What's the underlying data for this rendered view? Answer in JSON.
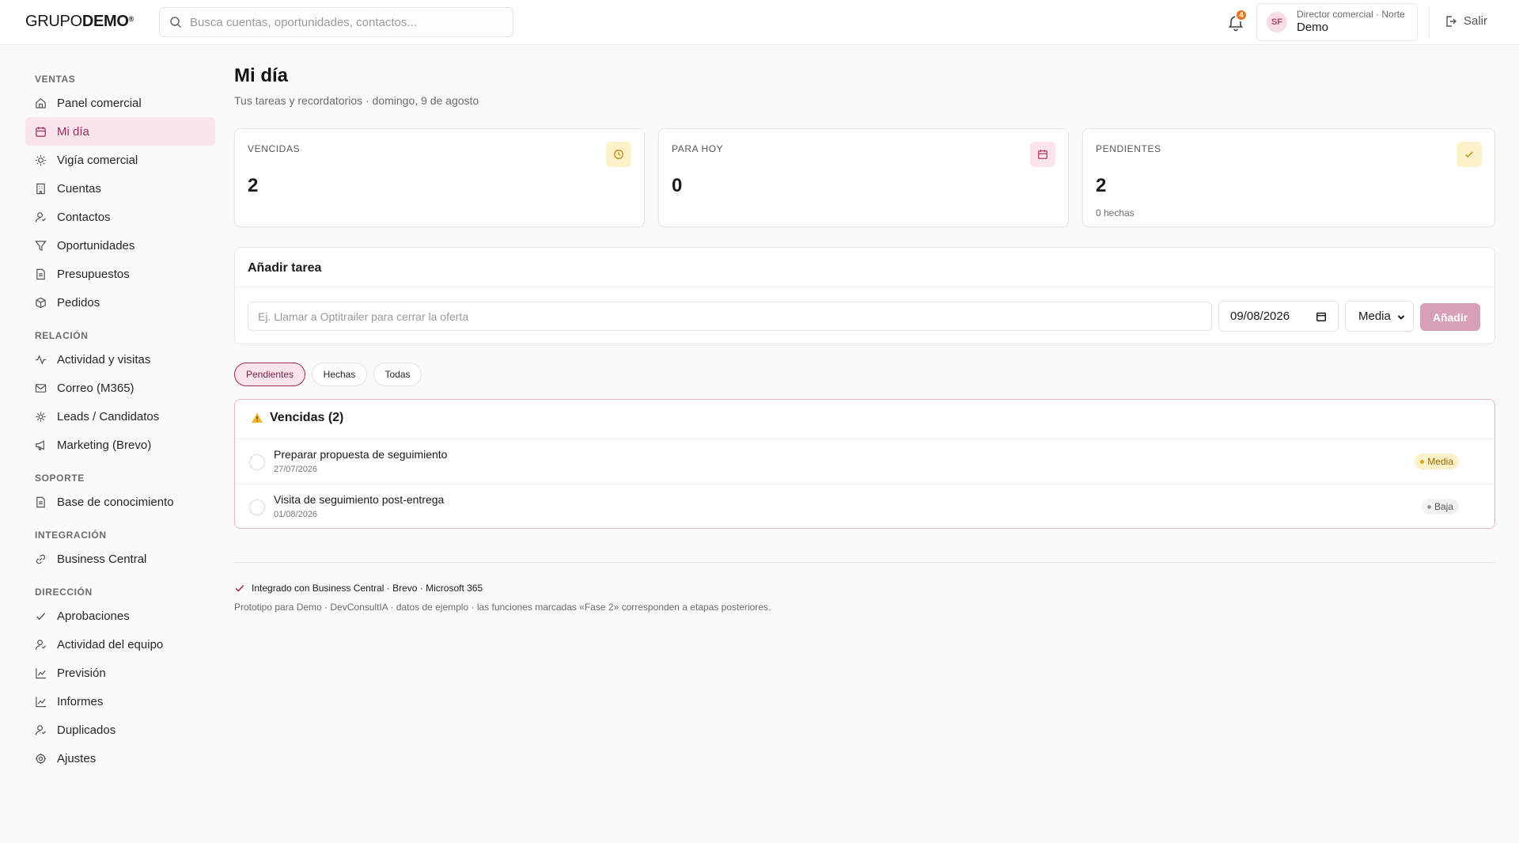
{
  "header": {
    "logo_light": "GRUPO",
    "logo_bold": "DEMO",
    "logo_mark": "®",
    "search_placeholder": "Busca cuentas, oportunidades, contactos...",
    "notification_count": "4",
    "user_initials": "SF",
    "user_role": "Director comercial · Norte",
    "user_name": "Demo",
    "logout_label": "Salir"
  },
  "sidebar": {
    "sections": [
      {
        "label": "VENTAS",
        "items": [
          {
            "label": "Panel comercial",
            "icon": "home-icon"
          },
          {
            "label": "Mi día",
            "icon": "calendar-icon",
            "active": true
          },
          {
            "label": "Vigía comercial",
            "icon": "sun-icon"
          },
          {
            "label": "Cuentas",
            "icon": "building-icon"
          },
          {
            "label": "Contactos",
            "icon": "contacts-icon"
          },
          {
            "label": "Oportunidades",
            "icon": "funnel-icon"
          },
          {
            "label": "Presupuestos",
            "icon": "document-icon"
          },
          {
            "label": "Pedidos",
            "icon": "package-icon"
          }
        ]
      },
      {
        "label": "RELACIÓN",
        "items": [
          {
            "label": "Actividad y visitas",
            "icon": "activity-icon"
          },
          {
            "label": "Correo (M365)",
            "icon": "mail-icon"
          },
          {
            "label": "Leads / Candidatos",
            "icon": "sparkle-icon"
          },
          {
            "label": "Marketing (Brevo)",
            "icon": "megaphone-icon"
          }
        ]
      },
      {
        "label": "SOPORTE",
        "items": [
          {
            "label": "Base de conocimiento",
            "icon": "document-icon"
          }
        ]
      },
      {
        "label": "INTEGRACIÓN",
        "items": [
          {
            "label": "Business Central",
            "icon": "link-icon"
          }
        ]
      },
      {
        "label": "DIRECCIÓN",
        "items": [
          {
            "label": "Aprobaciones",
            "icon": "check-icon"
          },
          {
            "label": "Actividad del equipo",
            "icon": "team-icon"
          },
          {
            "label": "Previsión",
            "icon": "chart-icon"
          },
          {
            "label": "Informes",
            "icon": "chart-icon"
          },
          {
            "label": "Duplicados",
            "icon": "duplicate-icon"
          },
          {
            "label": "Ajustes",
            "icon": "gear-icon"
          }
        ]
      }
    ]
  },
  "page": {
    "title": "Mi día",
    "subtitle": "Tus tareas y recordatorios · domingo, 9 de agosto"
  },
  "stats": [
    {
      "label": "VENCIDAS",
      "value": "2",
      "sub": "",
      "icon": "clock-icon",
      "icon_bg": "#fdf1c9",
      "icon_color": "#c8911a"
    },
    {
      "label": "PARA HOY",
      "value": "0",
      "sub": "",
      "icon": "calendar-icon",
      "icon_bg": "#fbe4ec",
      "icon_color": "#b0416a"
    },
    {
      "label": "PENDIENTES",
      "value": "2",
      "sub": "0 hechas",
      "icon": "check-icon",
      "icon_bg": "#fdf1c9",
      "icon_color": "#c8911a"
    }
  ],
  "add_task": {
    "title": "Añadir tarea",
    "placeholder": "Ej. Llamar a Optitrailer para cerrar la oferta",
    "date_value": "09/08/2026",
    "priority_value": "Media",
    "button_label": "Añadir"
  },
  "filters": [
    {
      "label": "Pendientes",
      "active": true
    },
    {
      "label": "Hechas",
      "active": false
    },
    {
      "label": "Todas",
      "active": false
    }
  ],
  "overdue": {
    "heading": "Vencidas (2)",
    "tasks": [
      {
        "title": "Preparar propuesta de seguimiento",
        "date": "27/07/2026",
        "priority": "Media",
        "badge_bg": "#fdf1c9",
        "badge_color": "#9a6a00",
        "dot_color": "#e0a11c"
      },
      {
        "title": "Visita de seguimiento post-entrega",
        "date": "01/08/2026",
        "priority": "Baja",
        "badge_bg": "#f2f2f2",
        "badge_color": "#555555",
        "dot_color": "#9a9a9a"
      }
    ]
  },
  "footer": {
    "integration": "Integrado con Business Central · Brevo · Microsoft 365",
    "prototype": "Prototipo para Demo · DevConsultIA · datos de ejemplo · las funciones marcadas «Fase 2» corresponden a etapas posteriores."
  },
  "colors": {
    "accent": "#9b2c57",
    "accent_soft": "#fbe4ec",
    "badge_orange": "#e8731c"
  }
}
